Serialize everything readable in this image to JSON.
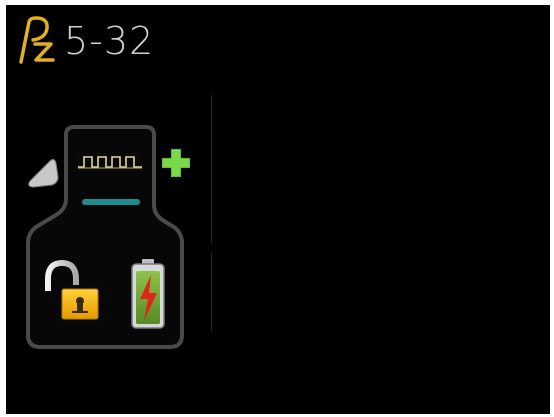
{
  "header": {
    "logo_icon": "pz-logo-icon",
    "model": "5-32"
  },
  "device": {
    "icons": [
      "transmitter-body-icon",
      "signal-waveform-icon",
      "add-plus-icon",
      "unlocked-padlock-icon",
      "battery-charging-icon"
    ],
    "accent_color": "#5fc22e",
    "lock_color": "#f2b000",
    "battery_color": "#6fa336",
    "led_color": "#1e8c8c"
  }
}
